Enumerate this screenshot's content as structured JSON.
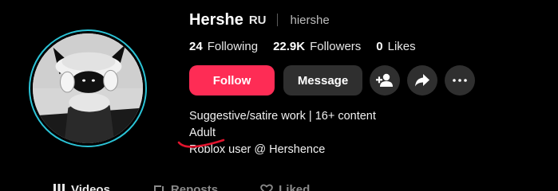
{
  "profile": {
    "display_name": "Hershe",
    "region": "RU",
    "username": "hiershe"
  },
  "stats": [
    {
      "value": "24",
      "label": "Following"
    },
    {
      "value": "22.9K",
      "label": "Followers"
    },
    {
      "value": "0",
      "label": "Likes"
    }
  ],
  "actions": {
    "follow_label": "Follow",
    "message_label": "Message"
  },
  "bio": {
    "line1": "Suggestive/satire work | 16+ content",
    "line2": "Adult",
    "line3": "Roblox user @ Hershence"
  },
  "tabs": [
    {
      "label": "Videos",
      "icon": "grid-icon"
    },
    {
      "label": "Reposts",
      "icon": "repost-icon"
    },
    {
      "label": "Liked",
      "icon": "heart-icon"
    }
  ],
  "colors": {
    "follow": "#fe2c55",
    "avatar_ring": "#2bc3d6",
    "annotation": "#e0142d",
    "button_bg": "#2f2f2f"
  }
}
